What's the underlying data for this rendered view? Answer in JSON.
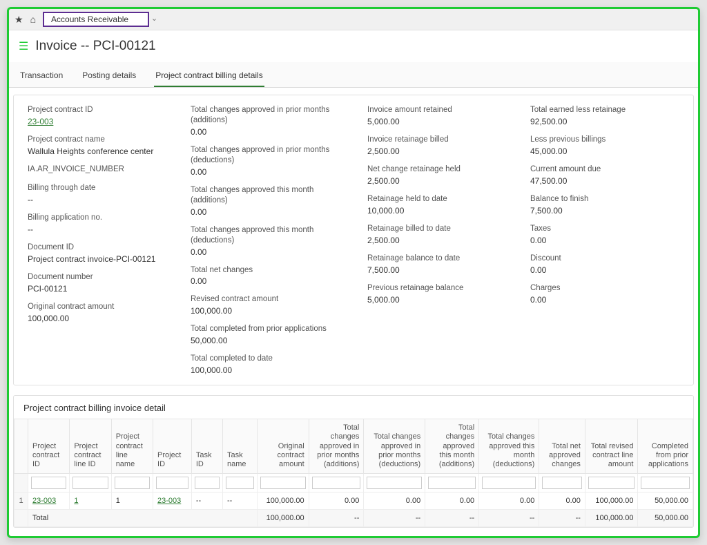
{
  "module_dropdown": "Accounts Receivable",
  "page_title": "Invoice -- PCI-00121",
  "tabs": {
    "transaction": "Transaction",
    "posting": "Posting details",
    "billing": "Project contract billing details"
  },
  "fields": {
    "c1": {
      "project_contract_id_l": "Project contract ID",
      "project_contract_id_v": "23-003",
      "project_contract_name_l": "Project contract name",
      "project_contract_name_v": "Wallula Heights conference center",
      "ia_ar_invoice_number_l": "IA.AR_INVOICE_NUMBER",
      "billing_through_date_l": "Billing through date",
      "billing_through_date_v": "--",
      "billing_app_no_l": "Billing application no.",
      "billing_app_no_v": "--",
      "document_id_l": "Document ID",
      "document_id_v": "Project contract invoice-PCI-00121",
      "document_number_l": "Document number",
      "document_number_v": "PCI-00121",
      "original_contract_amount_l": "Original contract amount",
      "original_contract_amount_v": "100,000.00"
    },
    "c2": {
      "t_chg_prior_add_l": "Total changes approved in prior months (additions)",
      "t_chg_prior_add_v": "0.00",
      "t_chg_prior_ded_l": "Total changes approved in prior months (deductions)",
      "t_chg_prior_ded_v": "0.00",
      "t_chg_this_add_l": "Total changes approved this month (additions)",
      "t_chg_this_add_v": "0.00",
      "t_chg_this_ded_l": "Total changes approved this month (deductions)",
      "t_chg_this_ded_v": "0.00",
      "total_net_changes_l": "Total net changes",
      "total_net_changes_v": "0.00",
      "revised_contract_amount_l": "Revised contract amount",
      "revised_contract_amount_v": "100,000.00",
      "total_completed_prior_l": "Total completed from prior applications",
      "total_completed_prior_v": "50,000.00",
      "total_completed_date_l": "Total completed to date",
      "total_completed_date_v": "100,000.00"
    },
    "c3": {
      "invoice_amount_retained_l": "Invoice amount retained",
      "invoice_amount_retained_v": "5,000.00",
      "invoice_retainage_billed_l": "Invoice retainage billed",
      "invoice_retainage_billed_v": "2,500.00",
      "net_change_retainage_held_l": "Net change retainage held",
      "net_change_retainage_held_v": "2,500.00",
      "retainage_held_to_date_l": "Retainage held to date",
      "retainage_held_to_date_v": "10,000.00",
      "retainage_billed_to_date_l": "Retainage billed to date",
      "retainage_billed_to_date_v": "2,500.00",
      "retainage_balance_to_date_l": "Retainage balance to date",
      "retainage_balance_to_date_v": "7,500.00",
      "previous_retainage_balance_l": "Previous retainage balance",
      "previous_retainage_balance_v": "5,000.00"
    },
    "c4": {
      "total_earned_less_ret_l": "Total earned less retainage",
      "total_earned_less_ret_v": "92,500.00",
      "less_previous_billings_l": "Less previous billings",
      "less_previous_billings_v": "45,000.00",
      "current_amount_due_l": "Current amount due",
      "current_amount_due_v": "47,500.00",
      "balance_to_finish_l": "Balance to finish",
      "balance_to_finish_v": "7,500.00",
      "taxes_l": "Taxes",
      "taxes_v": "0.00",
      "discount_l": "Discount",
      "discount_v": "0.00",
      "charges_l": "Charges",
      "charges_v": "0.00"
    }
  },
  "detail_section_title": "Project contract billing invoice detail",
  "table": {
    "headers": {
      "row": "",
      "pcid": "Project contract ID",
      "pclineid": "Project contract line ID",
      "pclinename": "Project contract line name",
      "projectid": "Project ID",
      "taskid": "Task ID",
      "taskname": "Task name",
      "orig_amt": "Original contract amount",
      "chg_prior_add": "Total changes approved in prior months (additions)",
      "chg_prior_ded": "Total changes approved in prior months (deductions)",
      "chg_this_add": "Total changes approved this month (additions)",
      "chg_this_ded": "Total changes approved this month (deductions)",
      "net_appr_chg": "Total net approved changes",
      "rev_line_amt": "Total revised contract line amount",
      "comp_prior": "Completed from prior applications"
    },
    "row": {
      "num": "1",
      "pcid": "23-003",
      "pclineid": "1",
      "pclinename": "1",
      "projectid": "23-003",
      "taskid": "--",
      "taskname": "--",
      "orig_amt": "100,000.00",
      "chg_prior_add": "0.00",
      "chg_prior_ded": "0.00",
      "chg_this_add": "0.00",
      "chg_this_ded": "0.00",
      "net_appr_chg": "0.00",
      "rev_line_amt": "100,000.00",
      "comp_prior": "50,000.00"
    },
    "total": {
      "label": "Total",
      "orig_amt": "100,000.00",
      "chg_prior_add": "--",
      "chg_prior_ded": "--",
      "chg_this_add": "--",
      "chg_this_ded": "--",
      "net_appr_chg": "--",
      "rev_line_amt": "100,000.00",
      "comp_prior": "50,000.00"
    }
  }
}
